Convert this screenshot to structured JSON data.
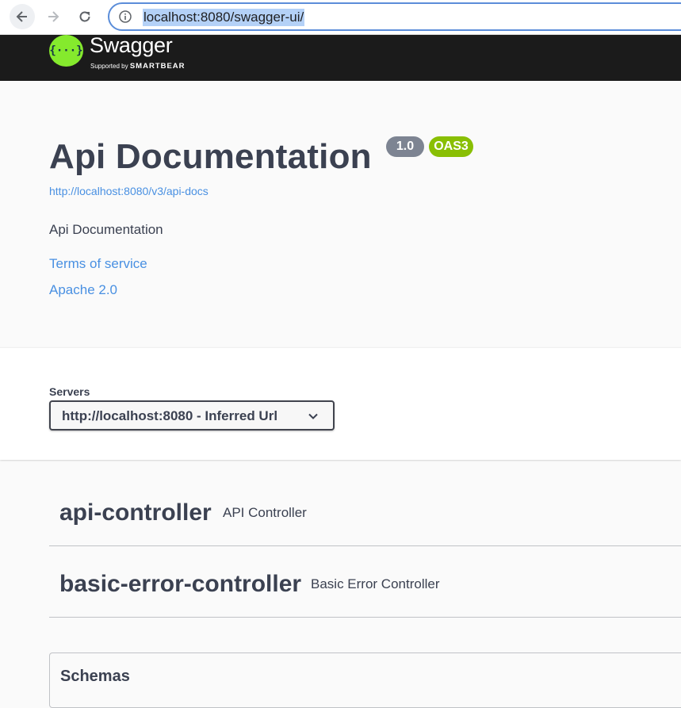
{
  "browser": {
    "url": "localhost:8080/swagger-ui/"
  },
  "topbar": {
    "logo_glyph": "{···}",
    "logo_text": "Swagger",
    "logo_sub_prefix": "Supported by",
    "logo_sub_brand": "SMARTBEAR"
  },
  "info": {
    "title": "Api Documentation",
    "version": "1.0",
    "oas_badge": "OAS3",
    "spec_url": "http://localhost:8080/v3/api-docs",
    "description": "Api Documentation",
    "terms": "Terms of service",
    "license": "Apache 2.0"
  },
  "servers": {
    "label": "Servers",
    "selected": "http://localhost:8080 - Inferred Url"
  },
  "tags": [
    {
      "name": "api-controller",
      "description": "API Controller"
    },
    {
      "name": "basic-error-controller",
      "description": "Basic Error Controller"
    }
  ],
  "schemas": {
    "title": "Schemas"
  },
  "colors": {
    "link": "#4990e2",
    "version_badge": "#7d8492",
    "oas_badge": "#89bf04",
    "topbar": "#1b1b1b",
    "logo": "#85ea2d"
  }
}
